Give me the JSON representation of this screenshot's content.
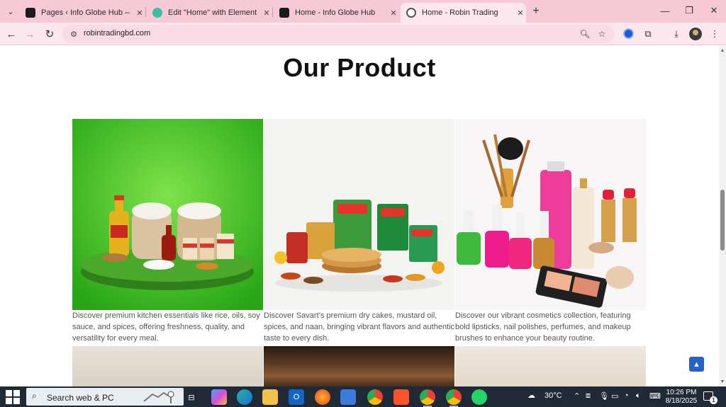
{
  "browser": {
    "tabs": [
      {
        "title": "Pages ‹ Info Globe Hub — Wo",
        "favicon_color": "#1a1a1a",
        "active": false
      },
      {
        "title": "Edit \"Home\" with Elementor",
        "favicon_color": "#3dbfa3",
        "active": false
      },
      {
        "title": "Home - Info Globe Hub",
        "favicon_color": "#1a1a1a",
        "active": false
      },
      {
        "title": "Home - Robin Trading",
        "favicon_color": "#555555",
        "active": true
      }
    ],
    "url": "robintradingbd.com",
    "tab_strip_color": "#f6c9d6",
    "toolbar_color": "#fde7ee"
  },
  "page": {
    "section_title": "Our Product",
    "products": [
      {
        "image_name": "grocery-essentials-image",
        "description": "Discover premium kitchen essentials like rice, oils, soy sauce, and spices, offering freshness, quality, and versatility for every meal."
      },
      {
        "image_name": "savart-food-image",
        "description": "Discover Savart’s premium dry cakes, mustard oil, spices, and naan, bringing vibrant flavors and authentic taste to every dish."
      },
      {
        "image_name": "cosmetics-image",
        "description": "Discover our vibrant cosmetics collection, featuring bold lipsticks, nail polishes, perfumes, and makeup brushes to enhance your beauty routine."
      }
    ],
    "accent_color": "#2563c9"
  },
  "taskbar": {
    "search_placeholder": "Search web & PC",
    "weather": "30°C",
    "time": "10:26 PM",
    "date": "8/18/2025",
    "notification_count": "1"
  }
}
